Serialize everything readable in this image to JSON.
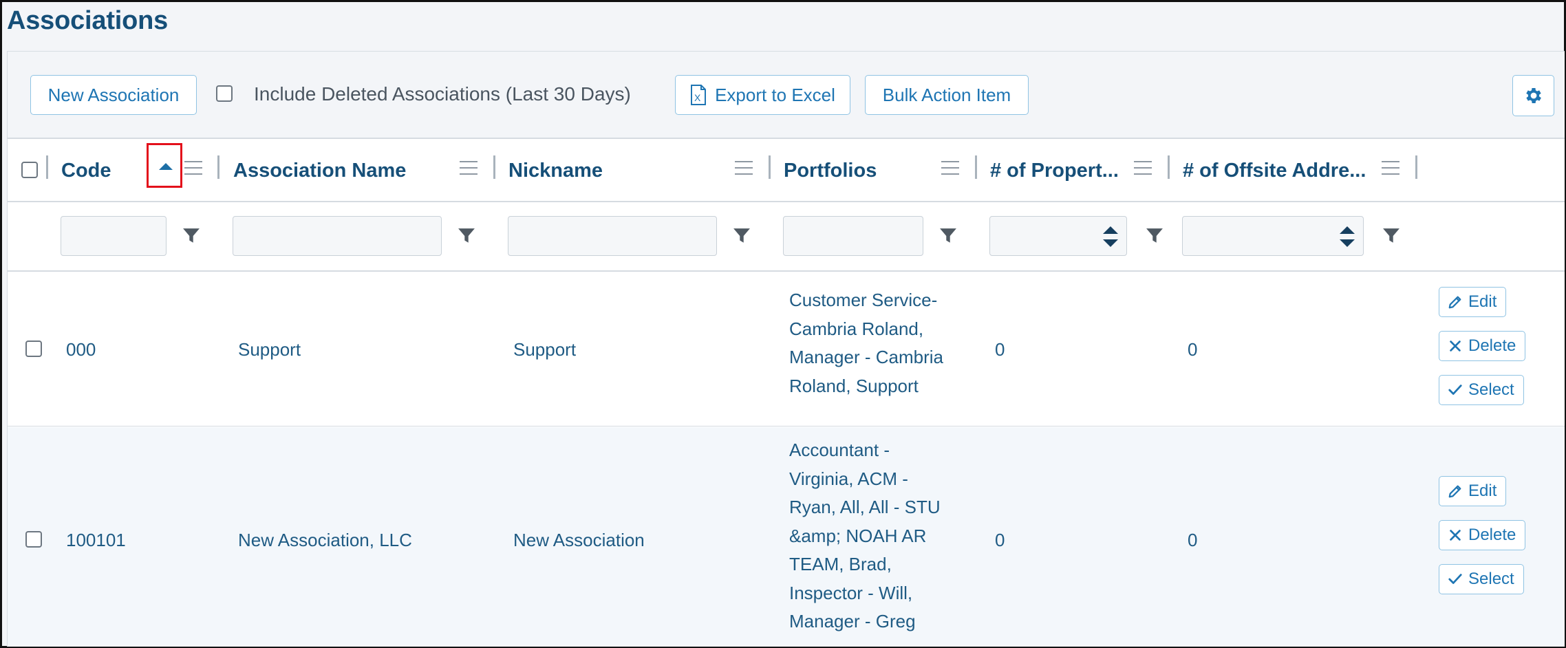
{
  "page": {
    "title": "Associations"
  },
  "toolbar": {
    "new_association_label": "New Association",
    "include_deleted_label": "Include Deleted Associations (Last 30 Days)",
    "include_deleted_checked": false,
    "export_label": "Export to Excel",
    "bulk_action_label": "Bulk Action Item",
    "settings_icon": "gear-icon"
  },
  "columns": [
    {
      "key": "code",
      "label": "Code",
      "sorted": "ascending"
    },
    {
      "key": "association_name",
      "label": "Association Name"
    },
    {
      "key": "nickname",
      "label": "Nickname"
    },
    {
      "key": "portfolios",
      "label": "Portfolios"
    },
    {
      "key": "num_properties",
      "label": "# of Propert..."
    },
    {
      "key": "num_offsite",
      "label": "# of Offsite Addre..."
    }
  ],
  "filters": {
    "code": "",
    "association_name": "",
    "nickname": "",
    "portfolios": "",
    "num_properties": "",
    "num_offsite": ""
  },
  "rows": [
    {
      "code": "000",
      "association_name": "Support",
      "nickname": "Support",
      "portfolios": "Customer Service-\nCambria Roland,\nManager - Cambria\nRoland, Support",
      "num_properties": "0",
      "num_offsite": "0"
    },
    {
      "code": "100101",
      "association_name": "New Association, LLC",
      "nickname": "New Association",
      "portfolios": "Accountant -\nVirginia, ACM -\nRyan, All, All - STU\n&amp; NOAH AR\nTEAM, Brad,\nInspector - Will,\nManager - Greg",
      "num_properties": "0",
      "num_offsite": "0"
    }
  ],
  "row_actions": {
    "edit": "Edit",
    "delete": "Delete",
    "select": "Select"
  },
  "colors": {
    "accent": "#1e75b3",
    "title": "#164f78",
    "sort_highlight": "#e3101b"
  }
}
